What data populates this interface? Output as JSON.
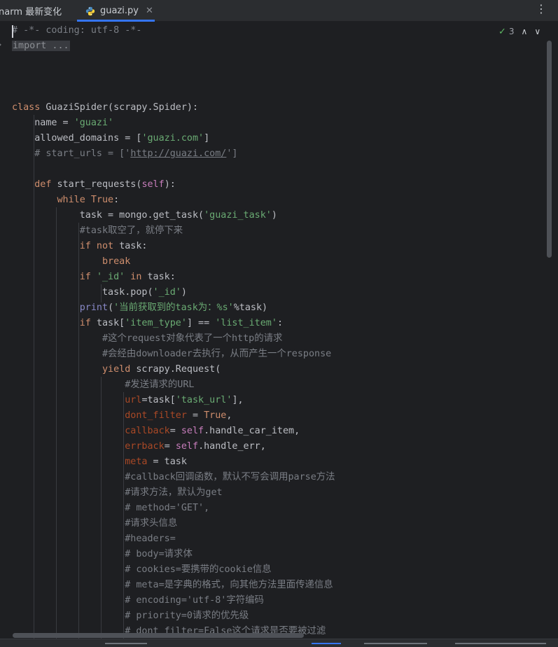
{
  "tabs": [
    {
      "label": "narm 最新变化",
      "active": false
    },
    {
      "label": "guazi.py",
      "active": true,
      "icon": "python-file-icon",
      "close": "✕"
    }
  ],
  "toolbar": {
    "more_icon": "⋮"
  },
  "inspection": {
    "icon": "check-icon",
    "count": "3",
    "up": "∧",
    "down": "∨"
  },
  "fold_marker": "›",
  "code": [
    [
      {
        "t": "# -*- coding: utf-8 -*-",
        "c": "c"
      }
    ],
    [
      {
        "t": "import ...",
        "c": "fold-bg"
      }
    ],
    [],
    [],
    [],
    [
      {
        "t": "class ",
        "c": "k"
      },
      {
        "t": "GuaziSpider(scrapy.Spider):"
      }
    ],
    [
      {
        "t": "    name = "
      },
      {
        "t": "'guazi'",
        "c": "s"
      }
    ],
    [
      {
        "t": "    allowed_domains = ["
      },
      {
        "t": "'guazi.com'",
        "c": "s"
      },
      {
        "t": "]"
      }
    ],
    [
      {
        "t": "    # start_urls = ['",
        "c": "c"
      },
      {
        "t": "http://guazi.com/",
        "c": "c u"
      },
      {
        "t": "']",
        "c": "c"
      }
    ],
    [],
    [
      {
        "t": "    "
      },
      {
        "t": "def ",
        "c": "k"
      },
      {
        "t": "start_requests("
      },
      {
        "t": "self",
        "c": "p"
      },
      {
        "t": "):"
      }
    ],
    [
      {
        "t": "        "
      },
      {
        "t": "while True",
        "c": "k"
      },
      {
        "t": ":"
      }
    ],
    [
      {
        "t": "            task = mongo.get_task("
      },
      {
        "t": "'guazi_task'",
        "c": "s"
      },
      {
        "t": ")"
      }
    ],
    [
      {
        "t": "            #task取空了，就停下来",
        "c": "c"
      }
    ],
    [
      {
        "t": "            "
      },
      {
        "t": "if not ",
        "c": "k"
      },
      {
        "t": "task:"
      }
    ],
    [
      {
        "t": "                "
      },
      {
        "t": "break",
        "c": "k"
      }
    ],
    [
      {
        "t": "            "
      },
      {
        "t": "if ",
        "c": "k"
      },
      {
        "t": "'_id'",
        "c": "s"
      },
      {
        "t": " in ",
        "c": "k"
      },
      {
        "t": "task:"
      }
    ],
    [
      {
        "t": "                task.pop("
      },
      {
        "t": "'_id'",
        "c": "s"
      },
      {
        "t": ")"
      }
    ],
    [
      {
        "t": "            "
      },
      {
        "t": "print",
        "c": "b"
      },
      {
        "t": "("
      },
      {
        "t": "'当前获取到的task为：%s'",
        "c": "s"
      },
      {
        "t": "%task)"
      }
    ],
    [
      {
        "t": "            "
      },
      {
        "t": "if ",
        "c": "k"
      },
      {
        "t": "task["
      },
      {
        "t": "'item_type'",
        "c": "s"
      },
      {
        "t": "] == "
      },
      {
        "t": "'list_item'",
        "c": "s"
      },
      {
        "t": ":"
      }
    ],
    [
      {
        "t": "                #这个request对象代表了一个http的请求",
        "c": "c"
      }
    ],
    [
      {
        "t": "                #会经由downloader去执行，从而产生一个response",
        "c": "c"
      }
    ],
    [
      {
        "t": "                "
      },
      {
        "t": "yield ",
        "c": "k"
      },
      {
        "t": "scrapy.Request("
      }
    ],
    [
      {
        "t": "                    #发送请求的URL",
        "c": "c"
      }
    ],
    [
      {
        "t": "                    "
      },
      {
        "t": "url",
        "c": "a"
      },
      {
        "t": "=task["
      },
      {
        "t": "'task_url'",
        "c": "s"
      },
      {
        "t": "],"
      }
    ],
    [
      {
        "t": "                    "
      },
      {
        "t": "dont_filter",
        "c": "a"
      },
      {
        "t": " = "
      },
      {
        "t": "True",
        "c": "k"
      },
      {
        "t": ","
      }
    ],
    [
      {
        "t": "                    "
      },
      {
        "t": "callback",
        "c": "a"
      },
      {
        "t": "= "
      },
      {
        "t": "self",
        "c": "p"
      },
      {
        "t": ".handle_car_item,"
      }
    ],
    [
      {
        "t": "                    "
      },
      {
        "t": "errback",
        "c": "a"
      },
      {
        "t": "= "
      },
      {
        "t": "self",
        "c": "p"
      },
      {
        "t": ".handle_err,"
      }
    ],
    [
      {
        "t": "                    "
      },
      {
        "t": "meta",
        "c": "a"
      },
      {
        "t": " = task"
      }
    ],
    [
      {
        "t": "                    #callback回调函数，默认不写会调用parse方法",
        "c": "c"
      }
    ],
    [
      {
        "t": "                    #请求方法，默认为get",
        "c": "c"
      }
    ],
    [
      {
        "t": "                    # method='GET',",
        "c": "c"
      }
    ],
    [
      {
        "t": "                    #请求头信息",
        "c": "c"
      }
    ],
    [
      {
        "t": "                    #headers=",
        "c": "c"
      }
    ],
    [
      {
        "t": "                    # body=请求体",
        "c": "c"
      }
    ],
    [
      {
        "t": "                    # cookies=要携带的cookie信息",
        "c": "c"
      }
    ],
    [
      {
        "t": "                    # meta=是字典的格式，向其他方法里面传递信息",
        "c": "c"
      }
    ],
    [
      {
        "t": "                    # encoding='utf-8'字符编码",
        "c": "c"
      }
    ],
    [
      {
        "t": "                    # priority=0请求的优先级",
        "c": "c"
      }
    ],
    [
      {
        "t": "                    # dont_filter=False这个请求是否要被过滤",
        "c": "c"
      }
    ]
  ]
}
